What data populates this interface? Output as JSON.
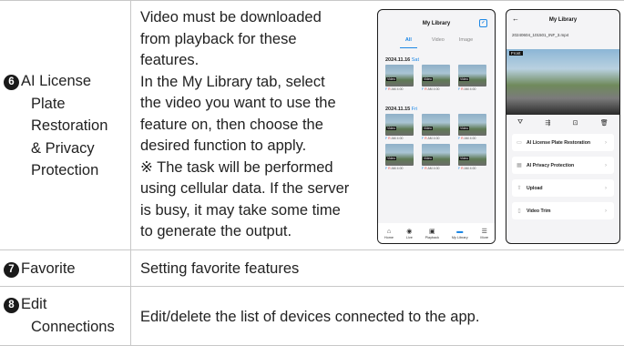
{
  "rows": [
    {
      "number": "6",
      "feature_lines": [
        "AI License",
        "Plate",
        "Restoration",
        "& Privacy",
        "Protection"
      ],
      "description_lines": [
        "Video must be downloaded",
        "from playback for these",
        "features.",
        "In the My Library tab, select",
        "the video you want to use the",
        "feature on, then choose the",
        "desired function to apply.",
        "※ The task will be performed",
        "using cellular data. If the server",
        "is busy, it may take some time",
        "to generate the output."
      ]
    },
    {
      "number": "7",
      "feature": "Favorite",
      "description": "Setting favorite features"
    },
    {
      "number": "8",
      "feature_lines": [
        "Edit",
        "Connections"
      ],
      "description": "Edit/delete the list of devices connected to the app."
    }
  ],
  "phone_library": {
    "title": "My Library",
    "tabs": [
      "All",
      "Video",
      "Image"
    ],
    "active_tab": "All",
    "groups": [
      {
        "date": "2024.11.16",
        "day": "Sat",
        "captions": [
          "AM 4:00",
          "AM 4:00",
          "AM 4:00"
        ]
      },
      {
        "date": "2024.11.15",
        "day": "Fri",
        "captions": [
          "AM 4:00",
          "AM 4:00",
          "AM 4:00",
          "AM 4:00",
          "AM 4:00",
          "AM 4:00"
        ]
      }
    ],
    "thumb_tag": "Video",
    "caption_prefix": "F R",
    "nav": [
      {
        "label": "Home",
        "icon": "home-icon",
        "glyph": "⌂"
      },
      {
        "label": "Live",
        "icon": "live-icon",
        "glyph": "◉"
      },
      {
        "label": "Playback",
        "icon": "playback-icon",
        "glyph": "▣"
      },
      {
        "label": "My Library",
        "icon": "folder-icon",
        "glyph": "▬"
      },
      {
        "label": "More",
        "icon": "menu-icon",
        "glyph": "☰"
      }
    ],
    "active_nav": "My Library",
    "accent": "#1e88e5"
  },
  "phone_detail": {
    "title": "My Library",
    "back_glyph": "←",
    "filename": "20240604_101501_INF_3.mp4",
    "view_tag": "Front",
    "tools": [
      "⛛",
      "⇶",
      "⊡",
      "🗑"
    ],
    "menu": [
      {
        "label": "AI License Plate Restoration",
        "glyph": "▭"
      },
      {
        "label": "AI Privacy Protection",
        "glyph": "▦"
      },
      {
        "label": "Upload",
        "glyph": "⇧"
      },
      {
        "label": "Video Trim",
        "glyph": "▯"
      }
    ],
    "chevron": "›"
  }
}
